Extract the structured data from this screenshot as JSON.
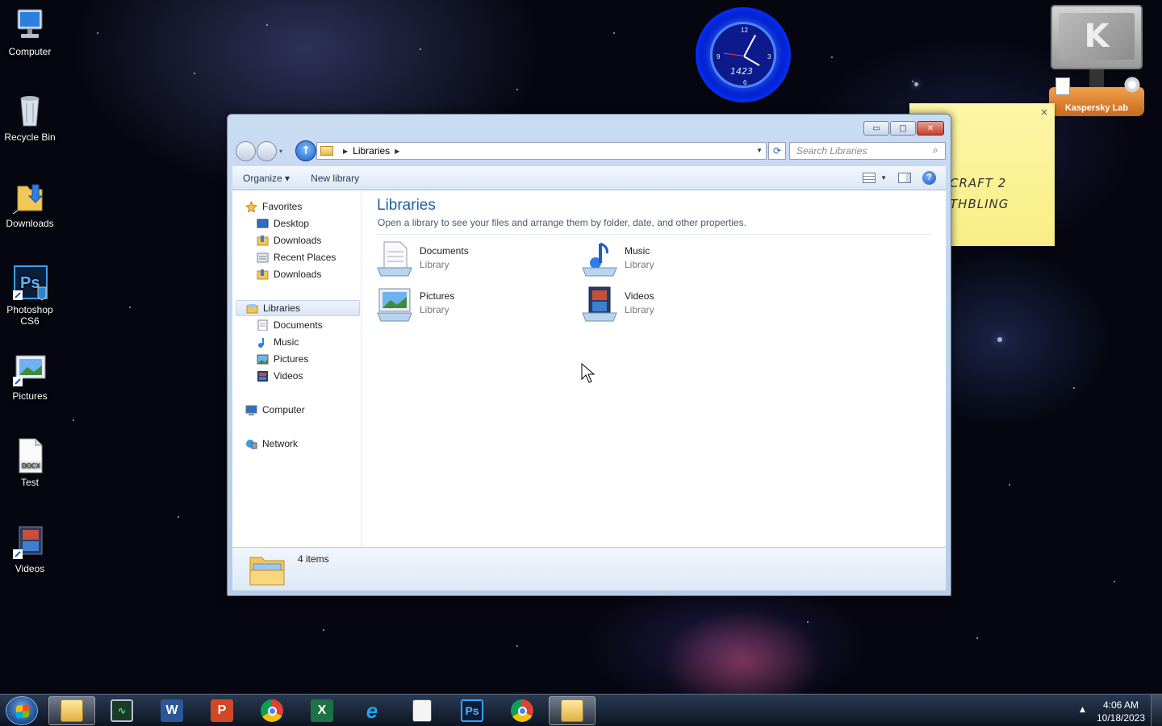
{
  "desktop": {
    "icons": [
      {
        "label": "Computer",
        "icon": "computer-icon"
      },
      {
        "label": "Recycle Bin",
        "icon": "recycle-bin-icon"
      },
      {
        "label": "Downloads",
        "icon": "downloads-folder-icon"
      },
      {
        "label": "Photoshop CS6",
        "icon": "photoshop-shortcut-icon"
      },
      {
        "label": "Pictures",
        "icon": "pictures-shortcut-icon"
      },
      {
        "label": "Test",
        "icon": "docx-file-icon"
      },
      {
        "label": "Videos",
        "icon": "videos-shortcut-icon"
      }
    ]
  },
  "clock_gadget": {
    "digits": "1423"
  },
  "kaspersky_gadget": {
    "label": "Kaspersky Lab",
    "logo": "K"
  },
  "sticky_note": {
    "line1": "CRAFT 2",
    "line2": "THBLING",
    "close": "×"
  },
  "explorer": {
    "window_controls": {
      "minimize": "▭",
      "maximize": "□",
      "close": "✕"
    },
    "address": {
      "breadcrumb": "Libraries"
    },
    "search": {
      "placeholder": "Search Libraries"
    },
    "toolbar": {
      "organize": "Organize",
      "organize_arrow": "▾",
      "new_library": "New library",
      "help": "?"
    },
    "nav": {
      "favorites": "Favorites",
      "favorites_items": [
        "Desktop",
        "Downloads",
        "Recent Places",
        "Downloads"
      ],
      "libraries": "Libraries",
      "libraries_items": [
        "Documents",
        "Music",
        "Pictures",
        "Videos"
      ],
      "computer": "Computer",
      "network": "Network"
    },
    "main": {
      "title": "Libraries",
      "subtitle": "Open a library to see your files and arrange them by folder, date, and other properties.",
      "libraries": [
        {
          "name": "Documents",
          "kind": "Library"
        },
        {
          "name": "Music",
          "kind": "Library"
        },
        {
          "name": "Pictures",
          "kind": "Library"
        },
        {
          "name": "Videos",
          "kind": "Library"
        }
      ]
    },
    "details": {
      "count": "4 items"
    }
  },
  "taskbar": {
    "apps": [
      "file-explorer",
      "task-manager",
      "word",
      "powerpoint",
      "chrome",
      "excel",
      "internet-explorer",
      "notepad",
      "photoshop",
      "chrome",
      "libraries-window"
    ],
    "tray_arrow": "▲",
    "time": "4:06 AM",
    "date": "10/18/2023"
  },
  "colors": {
    "accent": "#1e5fa6",
    "sticky": "#fdf6a6",
    "kaspersky": "#e08a32"
  }
}
